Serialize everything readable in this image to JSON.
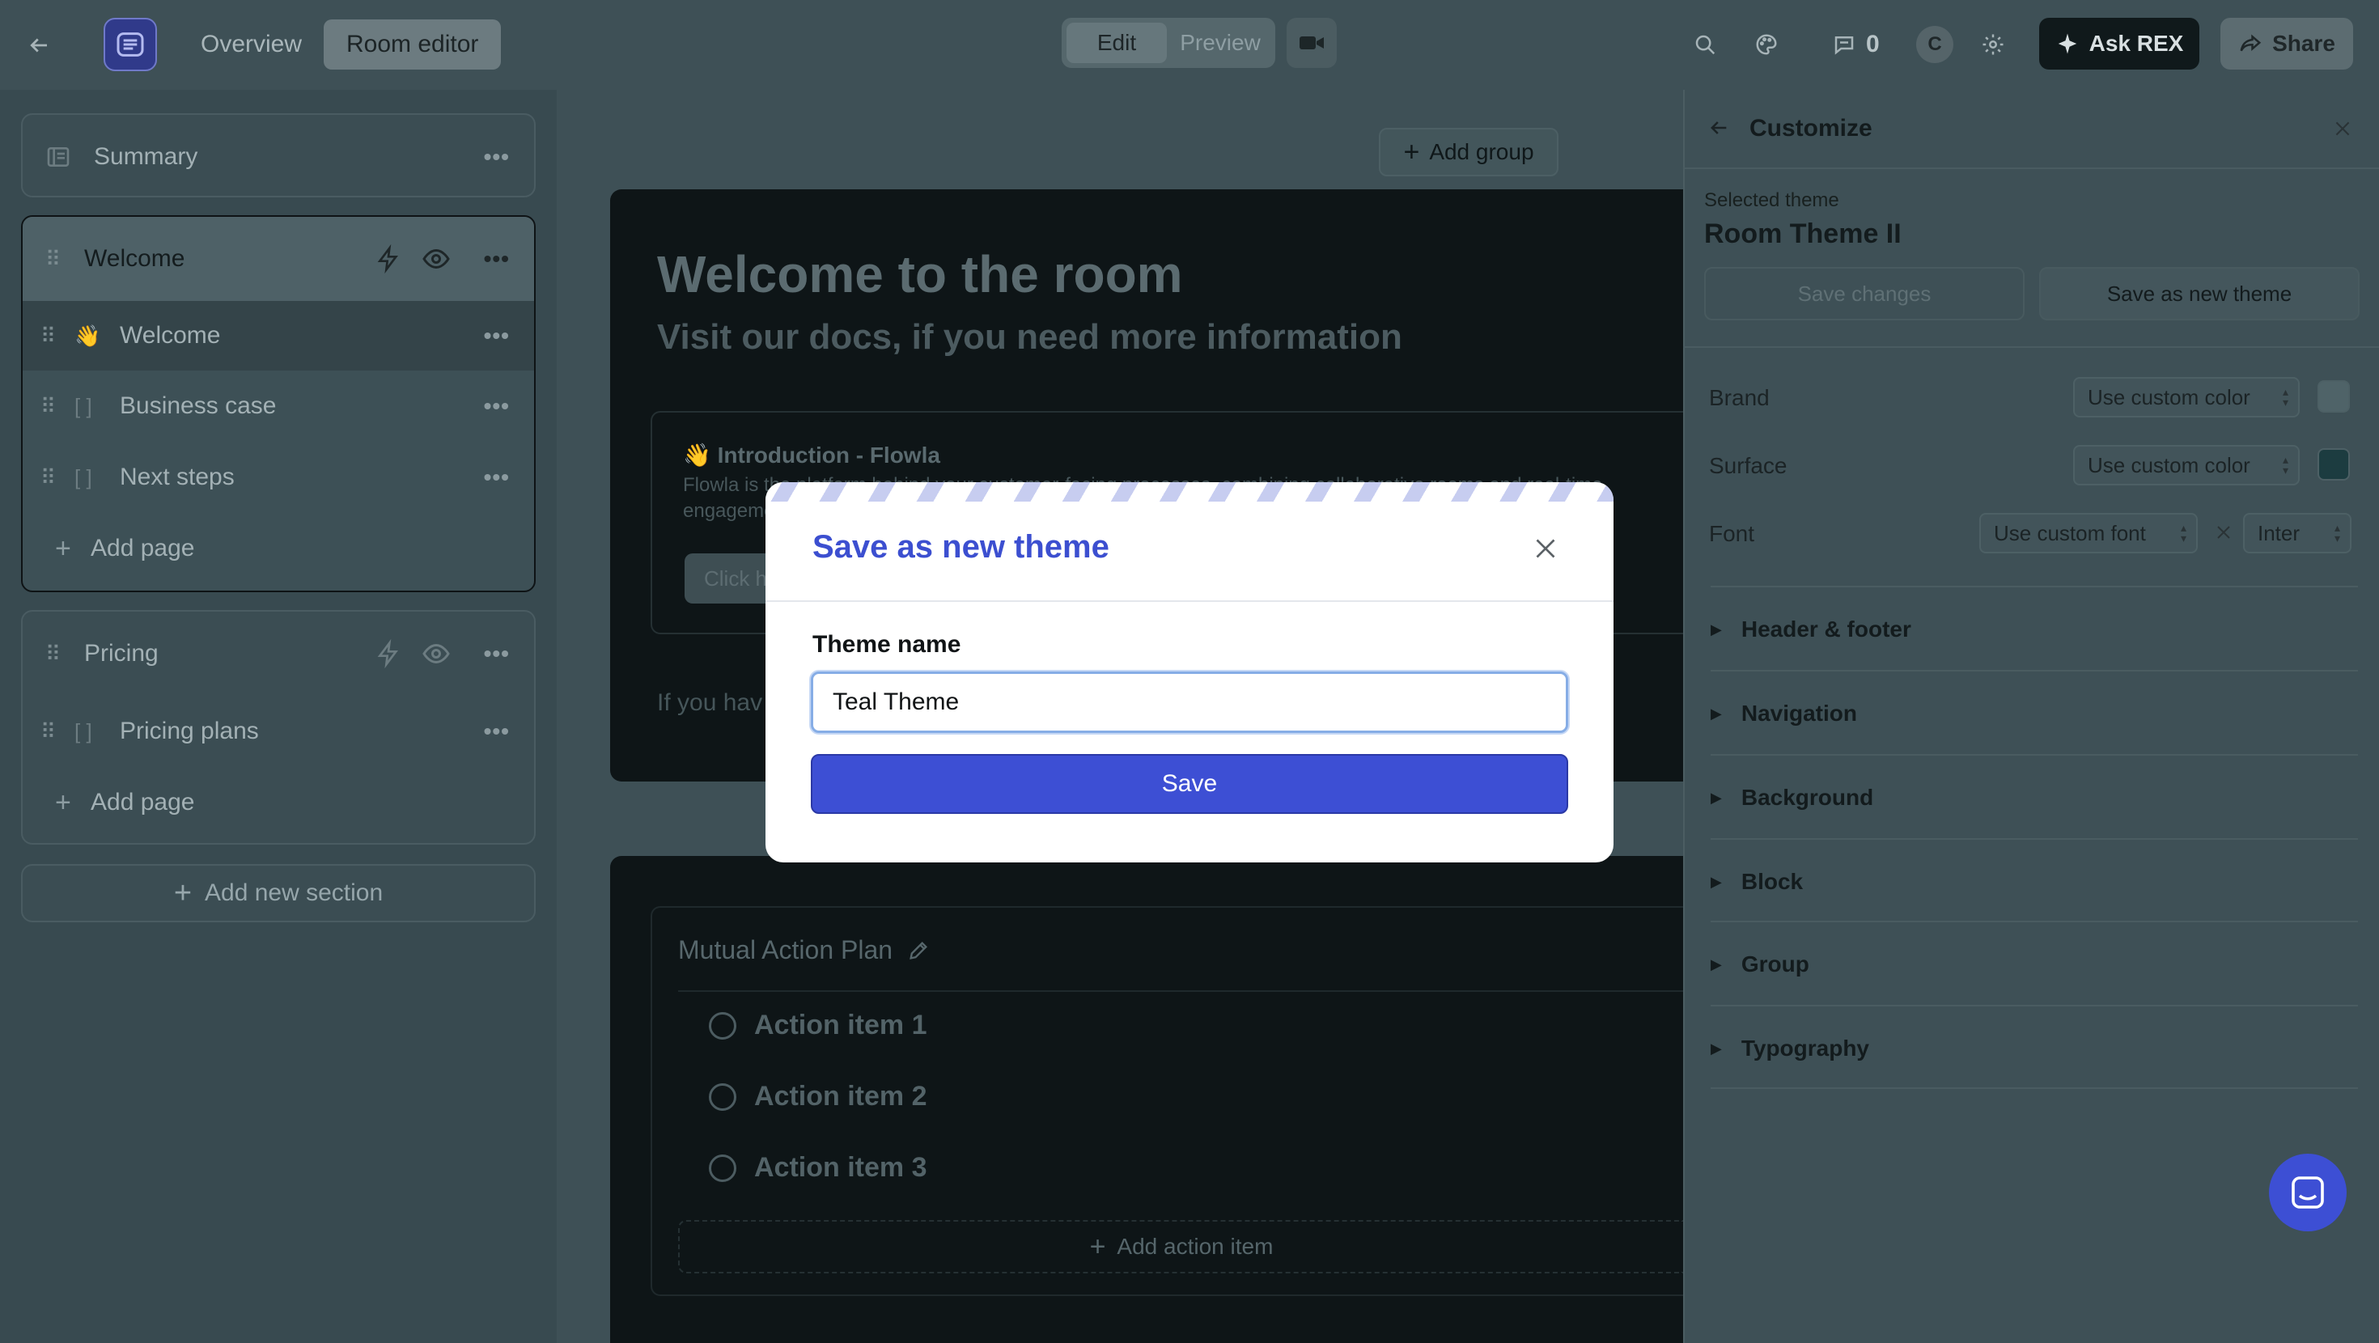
{
  "topbar": {
    "tabs": [
      "Overview",
      "Room editor"
    ],
    "mode": [
      "Edit",
      "Preview"
    ],
    "comments_count": "0",
    "avatar_initial": "C",
    "ask_label": "Ask REX",
    "share_label": "Share"
  },
  "sidebar": {
    "summary_label": "Summary",
    "welcome_section": {
      "title": "Welcome",
      "pages": [
        {
          "label": "Welcome",
          "emoji": "👋"
        },
        {
          "label": "Business case"
        },
        {
          "label": "Next steps"
        }
      ],
      "add_page": "Add page"
    },
    "pricing_section": {
      "title": "Pricing",
      "pages": [
        {
          "label": "Pricing plans"
        }
      ],
      "add_page": "Add page"
    },
    "add_section": "Add new section"
  },
  "main": {
    "add_group": "Add group",
    "welcome_title": "Welcome to the room",
    "welcome_subtitle": "Visit our docs, if you need more information",
    "intro_title": "👋 Introduction - Flowla",
    "intro_text": "Flowla is the platform behind your customer-facing processes, combining collaborative rooms and real-time engagement automations",
    "intro_button": "Click h",
    "if_you": "If you hav",
    "map_title": "Mutual Action Plan",
    "actions": [
      "Action item 1",
      "Action item 2",
      "Action item 3"
    ],
    "add_action": "Add action item"
  },
  "customize": {
    "title": "Customize",
    "selected_label": "Selected theme",
    "selected_name": "Room Theme II",
    "save_changes": "Save changes",
    "save_new": "Save as new theme",
    "brand_label": "Brand",
    "surface_label": "Surface",
    "font_label": "Font",
    "custom_color": "Use custom color",
    "custom_font": "Use custom font",
    "font_value": "Inter",
    "sections": [
      "Header & footer",
      "Navigation",
      "Background",
      "Block",
      "Group",
      "Typography"
    ],
    "brand_color": "#4f6368",
    "surface_color": "#1c3c40"
  },
  "modal": {
    "title": "Save as new theme",
    "field_label": "Theme name",
    "field_value": "Teal Theme",
    "save_label": "Save"
  },
  "colors": {
    "accent": "#3d4fd4"
  }
}
